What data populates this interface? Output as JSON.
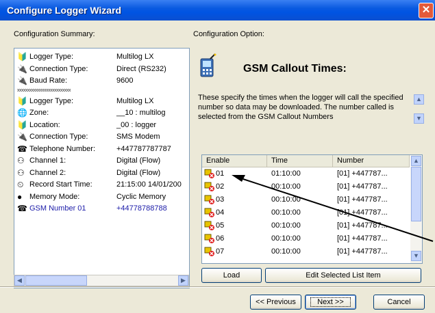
{
  "window": {
    "title": "Configure Logger Wizard",
    "close_glyph": "✕"
  },
  "left": {
    "header": "Configuration Summary:",
    "items": [
      {
        "icon": "logger-icon",
        "glyph": "🔰",
        "label": "Logger Type:",
        "value": "Multilog LX"
      },
      {
        "icon": "connection-icon",
        "glyph": "🔌",
        "label": "Connection Type:",
        "value": "Direct (RS232)"
      },
      {
        "icon": "baud-icon",
        "glyph": "🔌",
        "label": "Baud Rate:",
        "value": "9600"
      },
      {
        "icon": "logger-icon",
        "glyph": "🔰",
        "label": "Logger Type:",
        "value": "Multilog LX"
      },
      {
        "icon": "zone-icon",
        "glyph": "🌐",
        "label": "Zone:",
        "value": "__10 : multilog"
      },
      {
        "icon": "location-icon",
        "glyph": "🔰",
        "label": "Location:",
        "value": "_00 : logger"
      },
      {
        "icon": "connection-icon",
        "glyph": "🔌",
        "label": "Connection Type:",
        "value": "SMS Modem"
      },
      {
        "icon": "phone-icon",
        "glyph": "☎",
        "label": "Telephone Number:",
        "value": "+447787787787"
      },
      {
        "icon": "channel-icon",
        "glyph": "⚇",
        "label": "Channel 1:",
        "value": "Digital (Flow)"
      },
      {
        "icon": "channel-icon",
        "glyph": "⚇",
        "label": "Channel 2:",
        "value": "Digital (Flow)"
      },
      {
        "icon": "clock-icon",
        "glyph": "⏲",
        "label": "Record Start Time:",
        "value": "21:15:00 14/01/200"
      },
      {
        "icon": "memory-icon",
        "glyph": "●",
        "label": "Memory Mode:",
        "value": "Cyclic Memory"
      },
      {
        "icon": "gsm-icon",
        "glyph": "☎",
        "label": "GSM Number 01",
        "value": "+44778788788"
      }
    ],
    "separator": "xxxxxxxxxxxxxxxxxxxxxxxxxx"
  },
  "right": {
    "header": "Configuration Option:",
    "title": "GSM Callout Times:",
    "description": "These specify the times when the logger will call the specified number so data may be downloaded. The number called is selected from the GSM Callout Numbers",
    "columns": [
      "Enable",
      "Time",
      "Number"
    ],
    "rows": [
      {
        "enable": "01",
        "time": "01:10:00",
        "number": "[01] +447787..."
      },
      {
        "enable": "02",
        "time": "00:10:00",
        "number": "[01] +447787..."
      },
      {
        "enable": "03",
        "time": "00:10:00",
        "number": "[01] +447787..."
      },
      {
        "enable": "04",
        "time": "00:10:00",
        "number": "[01] +447787..."
      },
      {
        "enable": "05",
        "time": "00:10:00",
        "number": "[01] +447787..."
      },
      {
        "enable": "06",
        "time": "00:10:00",
        "number": "[01] +447787..."
      },
      {
        "enable": "07",
        "time": "00:10:00",
        "number": "[01] +447787..."
      }
    ],
    "load_label": "Load",
    "edit_label": "Edit Selected List Item"
  },
  "footer": {
    "previous": "<< Previous",
    "next": "Next >>",
    "cancel": "Cancel"
  },
  "colors": {
    "title_bar": "#0054e3",
    "selected_text": "#1a1aa8",
    "disabled_icon": "#e02020"
  }
}
